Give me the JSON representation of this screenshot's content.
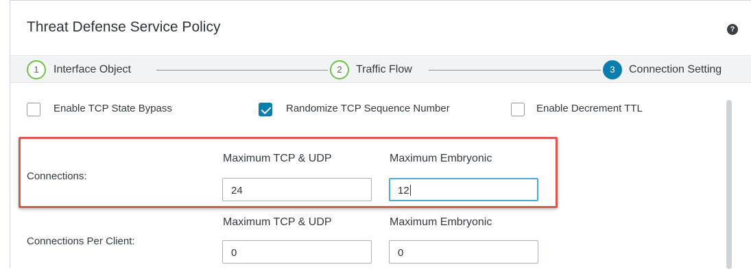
{
  "dialog": {
    "title": "Threat Defense Service Policy",
    "help_icon": "?"
  },
  "steps": [
    {
      "number": "1",
      "label": "Interface Object",
      "state": "completed"
    },
    {
      "number": "2",
      "label": "Traffic Flow",
      "state": "completed"
    },
    {
      "number": "3",
      "label": "Connection Setting",
      "state": "active"
    }
  ],
  "options": [
    {
      "label": "Enable TCP State Bypass",
      "checked": false
    },
    {
      "label": "Randomize TCP Sequence Number",
      "checked": true
    },
    {
      "label": "Enable Decrement TTL",
      "checked": false
    }
  ],
  "connections": {
    "label": "Connections:",
    "col1_label": "Maximum TCP & UDP",
    "col2_label": "Maximum Embryonic",
    "max_tcp_udp": "24",
    "max_embryonic": "12"
  },
  "connections_per_client": {
    "label": "Connections Per Client:",
    "col1_label": "Maximum TCP & UDP",
    "col2_label": "Maximum Embryonic",
    "max_tcp_udp": "0",
    "max_embryonic": "0"
  },
  "colors": {
    "step_completed": "#6cc04a",
    "step_active": "#0a7fae",
    "checkbox_checked": "#0a7fae",
    "highlight_border": "#d9574f",
    "focus_border": "#4aa9d6"
  }
}
